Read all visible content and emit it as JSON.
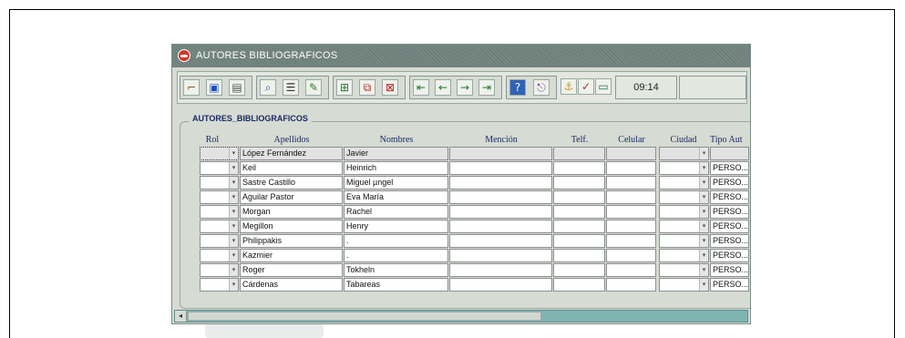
{
  "window": {
    "title": "AUTORES BIBLIOGRAFICOS"
  },
  "toolbar": {
    "clock": "09:14",
    "groups": [
      {
        "icons": [
          "broom-icon",
          "save-icon",
          "print-icon"
        ]
      },
      {
        "icons": [
          "search-icon",
          "list-icon",
          "edit-icon"
        ]
      },
      {
        "icons": [
          "insert-record-icon",
          "duplicate-record-icon",
          "delete-record-icon"
        ]
      },
      {
        "icons": [
          "first-record-icon",
          "previous-record-icon",
          "next-record-icon",
          "last-record-icon"
        ]
      },
      {
        "icons": [
          "help-icon",
          "exit-icon"
        ]
      },
      {
        "icons": [
          "anchor-icon",
          "check-icon",
          "calendar-icon"
        ]
      }
    ]
  },
  "block": {
    "label": "AUTORES_BIBLIOGRAFICOS"
  },
  "columns": {
    "rol": "Rol",
    "apellidos": "Apellidos",
    "nombres": "Nombres",
    "mencion": "Mención",
    "telf": "Telf.",
    "celular": "Celular",
    "ciudad": "Ciudad",
    "tipo": "Tipo Aut"
  },
  "rows": [
    {
      "apellidos": "López Fernández",
      "nombres": "Javier",
      "tipo": ""
    },
    {
      "apellidos": "Keil",
      "nombres": "Heinrich",
      "tipo": "PERSO..."
    },
    {
      "apellidos": "Sastre Castillo",
      "nombres": "Miguel µngel",
      "tipo": "PERSO..."
    },
    {
      "apellidos": "Aguilar Pastor",
      "nombres": "Eva María",
      "tipo": "PERSO..."
    },
    {
      "apellidos": "Morgan",
      "nombres": "Rachel",
      "tipo": "PERSO..."
    },
    {
      "apellidos": "Megillon",
      "nombres": "Henry",
      "tipo": "PERSO..."
    },
    {
      "apellidos": "Philippakis",
      "nombres": ".",
      "tipo": "PERSO..."
    },
    {
      "apellidos": "Kazmier",
      "nombres": ".",
      "tipo": "PERSO..."
    },
    {
      "apellidos": "Roger",
      "nombres": "Tokheln",
      "tipo": "PERSO..."
    },
    {
      "apellidos": "Cárdenas",
      "nombres": "Tabareas",
      "tipo": "PERSO..."
    }
  ]
}
